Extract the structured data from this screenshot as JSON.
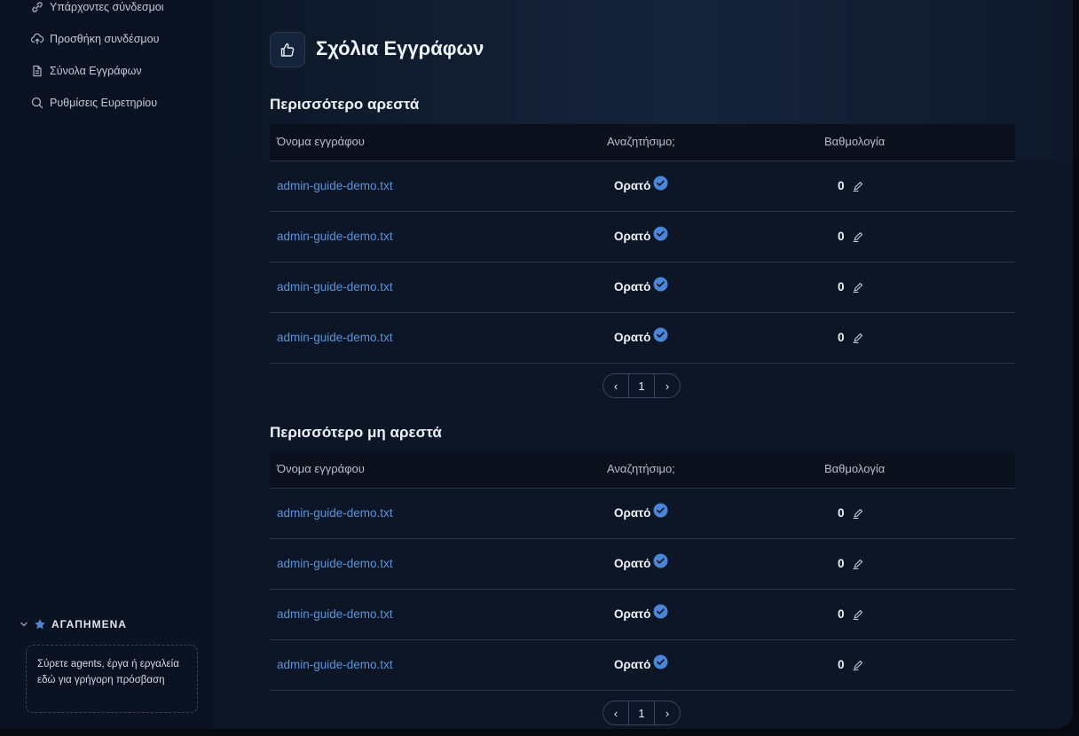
{
  "sidebar": {
    "items": [
      {
        "label": "Υπάρχοντες σύνδεσμοι",
        "icon": "link-icon"
      },
      {
        "label": "Προσθήκη συνδέσμου",
        "icon": "cloud-upload-icon"
      },
      {
        "label": "Σύνολα Εγγράφων",
        "icon": "documents-icon"
      },
      {
        "label": "Ρυθμίσεις Ευρετηρίου",
        "icon": "search-icon"
      }
    ],
    "favorites": {
      "title": "ΑΓΑΠΗΜΕΝΑ",
      "hint": "Σύρετε agents, έργα ή εργαλεία εδώ για γρήγορη πρόσβαση"
    }
  },
  "page": {
    "title": "Σχόλια Εγγράφων",
    "icon": "thumbs-up-icon"
  },
  "columns": {
    "name": "Όνομα εγγράφου",
    "searchable": "Αναζητήσιμο;",
    "score": "Βαθμολογία"
  },
  "sections": [
    {
      "title": "Περισσότερο αρεστά",
      "rows": [
        {
          "name": "admin-guide-demo.txt",
          "visibility": "Ορατό",
          "score": "0"
        },
        {
          "name": "admin-guide-demo.txt",
          "visibility": "Ορατό",
          "score": "0"
        },
        {
          "name": "admin-guide-demo.txt",
          "visibility": "Ορατό",
          "score": "0"
        },
        {
          "name": "admin-guide-demo.txt",
          "visibility": "Ορατό",
          "score": "0"
        }
      ],
      "pager": {
        "prev": "‹",
        "page": "1",
        "next": "›"
      }
    },
    {
      "title": "Περισσότερο μη αρεστά",
      "rows": [
        {
          "name": "admin-guide-demo.txt",
          "visibility": "Ορατό",
          "score": "0"
        },
        {
          "name": "admin-guide-demo.txt",
          "visibility": "Ορατό",
          "score": "0"
        },
        {
          "name": "admin-guide-demo.txt",
          "visibility": "Ορατό",
          "score": "0"
        },
        {
          "name": "admin-guide-demo.txt",
          "visibility": "Ορατό",
          "score": "0"
        }
      ],
      "pager": {
        "prev": "‹",
        "page": "1",
        "next": "›"
      }
    }
  ],
  "colors": {
    "accent": "#5b93d9",
    "check": "#4a86d8",
    "background": "#0c1626"
  }
}
